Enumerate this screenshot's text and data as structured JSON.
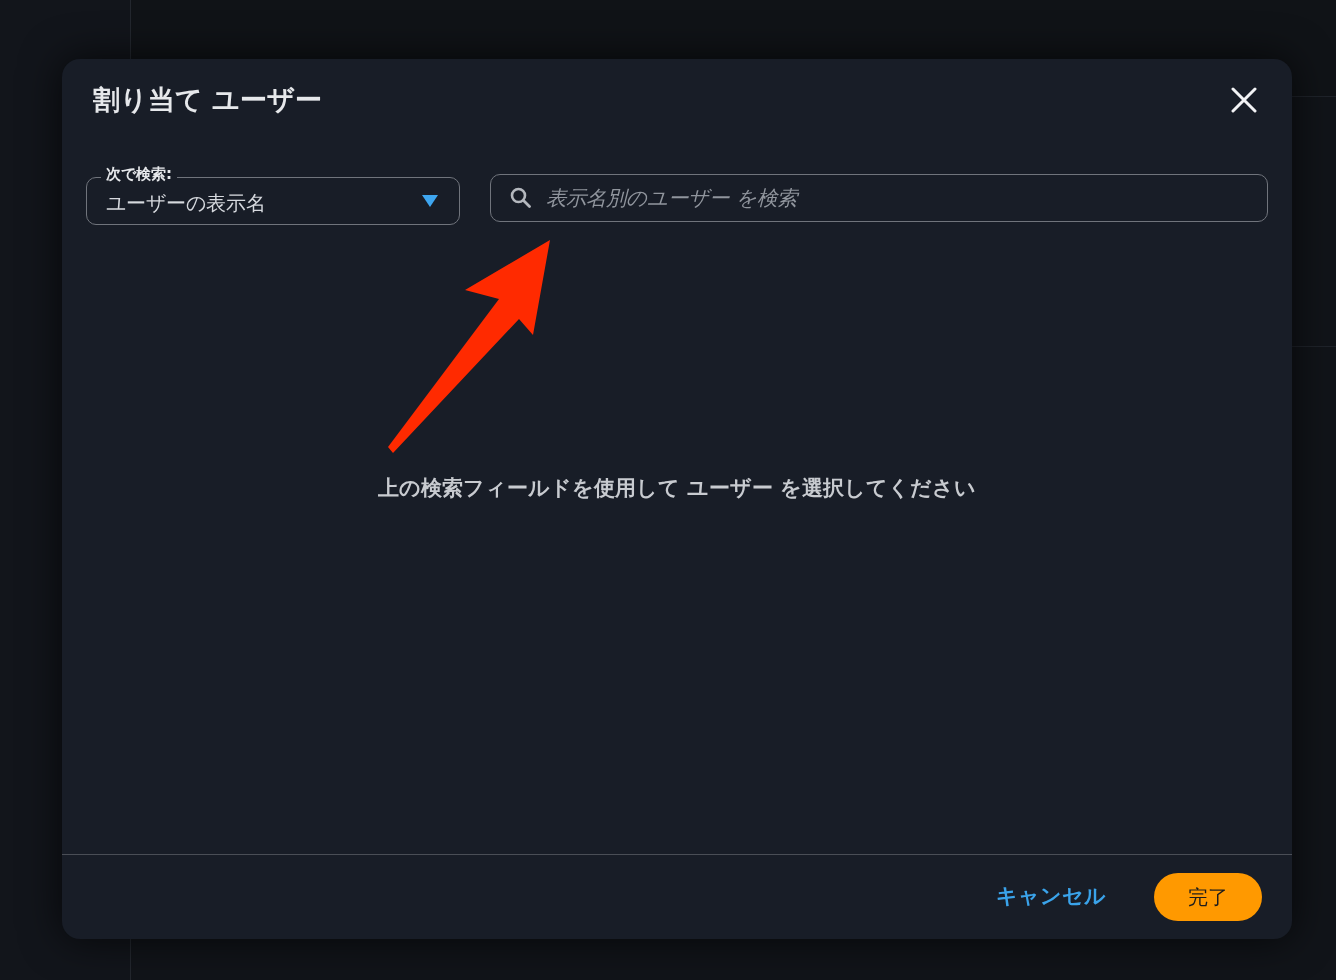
{
  "dialog": {
    "title": "割り当て ユーザー",
    "search_by": {
      "label": "次で検索:",
      "value": "ユーザーの表示名"
    },
    "search_field": {
      "placeholder": "表示名別のユーザー を検索"
    },
    "empty_message": "上の検索フィールドを使用して ユーザー を選択してください",
    "buttons": [
      {
        "label": "キャンセル",
        "kind": "text"
      },
      {
        "label": "完了",
        "kind": "primary"
      }
    ]
  }
}
